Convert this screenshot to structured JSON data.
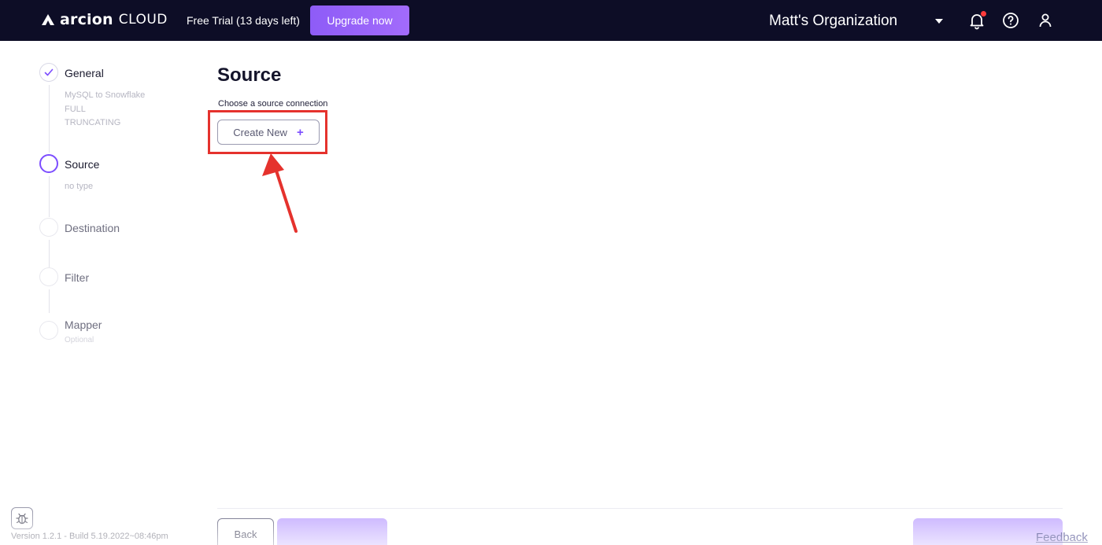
{
  "header": {
    "logo_word": "arcion",
    "logo_suffix": "CLOUD",
    "trial_text": "Free Trial (13 days left)",
    "upgrade_label": "Upgrade now",
    "org_name": "Matt's Organization"
  },
  "stepper": {
    "steps": [
      {
        "title": "General",
        "state": "done",
        "details": [
          "MySQL to Snowflake",
          "FULL",
          "TRUNCATING"
        ]
      },
      {
        "title": "Source",
        "state": "active",
        "details": [
          "no type"
        ]
      },
      {
        "title": "Destination",
        "state": "pending",
        "details": []
      },
      {
        "title": "Filter",
        "state": "pending",
        "details": []
      },
      {
        "title": "Mapper",
        "state": "pending",
        "details": [
          "Optional"
        ]
      }
    ]
  },
  "main": {
    "title": "Source",
    "subtitle": "Choose a source connection",
    "create_label": "Create New"
  },
  "footer": {
    "back_label": "Back",
    "version_text": "Version 1.2.1 - Build 5.19.2022~08:46pm",
    "feedback_label": "Feedback"
  },
  "colors": {
    "header_bg": "#0d0d26",
    "accent": "#7c4dff",
    "annotation": "#e5322d"
  }
}
